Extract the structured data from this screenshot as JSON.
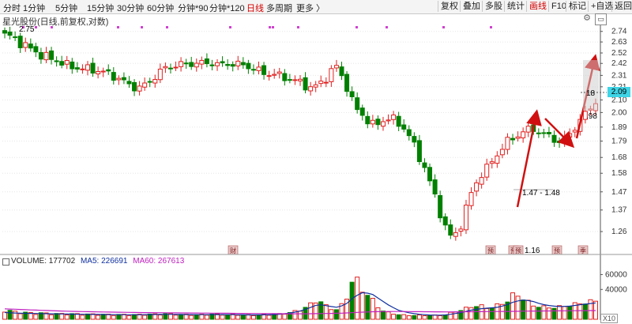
{
  "toolbar": {
    "periods": [
      "分时",
      "1分钟",
      "5分钟",
      "15分钟",
      "30分钟",
      "60分钟",
      "分钟*90",
      "分钟*120",
      "日线",
      "多周期",
      "更多 〉"
    ],
    "active_period": "日线",
    "buttons": [
      "复权",
      "叠加",
      "多股",
      "统计",
      "画线",
      "F10",
      "标记",
      "+自选",
      "返回"
    ],
    "active_button": "画线",
    "settings_icon": "gear-icon"
  },
  "stock_title": "星光股份(日线,前复权,对数)",
  "price_axis": {
    "ticks": [
      2.74,
      2.63,
      2.52,
      2.42,
      2.31,
      2.21,
      2.1,
      2.0,
      1.89,
      1.79,
      1.68,
      1.58,
      1.47,
      1.37,
      1.26
    ],
    "labels": [
      "2.74",
      "2.63",
      "2.52",
      "2.42",
      "2.31",
      "2.21",
      "2.10",
      "2.00",
      "1.89",
      "1.79",
      "1.68",
      "1.58",
      "1.47",
      "1.37",
      "1.26"
    ],
    "current_price_label": "2.09"
  },
  "volume_axis": {
    "ticks": [
      60000,
      40000
    ],
    "labels": [
      "60000",
      "40000"
    ],
    "x10_label": "X10"
  },
  "volume_header": {
    "volume": "VOLUME: 177702",
    "ma5": "MA5: 226691",
    "ma60": "MA60: 267613"
  },
  "annotations": {
    "start_high": "2.75",
    "low": "1.16",
    "range_label": "1.47 - 1.48",
    "box_left": "18",
    "box_right": ".98"
  },
  "event_markers": [
    "财",
    "预",
    "预",
    "预",
    "预",
    "季"
  ],
  "colors": {
    "up": "#e02020",
    "down": "#008000",
    "ma5": "#1030a0",
    "ma60": "#c020c0",
    "arrow": "#d01010",
    "price_tag": "#3fd4e6"
  },
  "chart_data": {
    "type": "candlestick",
    "title": "星光股份(日线,前复权,对数)",
    "scale": "log",
    "ylim": [
      1.16,
      2.78
    ],
    "price_high": 2.75,
    "price_low": 1.16,
    "last_price": 2.09,
    "grid": true,
    "close_path": [
      2.7,
      2.68,
      2.6,
      2.56,
      2.5,
      2.47,
      2.44,
      2.4,
      2.38,
      2.37,
      2.36,
      2.34,
      2.31,
      2.27,
      2.22,
      2.2,
      2.24,
      2.32,
      2.38,
      2.4,
      2.41,
      2.42,
      2.42,
      2.43,
      2.4,
      2.42,
      2.41,
      2.4,
      2.36,
      2.33,
      2.32,
      2.3,
      2.27,
      2.25,
      2.2,
      2.22,
      2.3,
      2.4,
      2.25,
      2.05,
      1.98,
      1.9,
      1.93,
      1.96,
      1.92,
      1.85,
      1.72,
      1.6,
      1.45,
      1.3,
      1.22,
      1.3,
      1.45,
      1.56,
      1.62,
      1.7,
      1.78,
      1.82,
      1.86,
      1.88,
      1.84,
      1.82,
      1.78,
      1.83,
      1.92,
      2.0,
      2.09
    ],
    "volume_path": [
      12000,
      10000,
      9000,
      8000,
      8000,
      7500,
      7000,
      7000,
      6800,
      6500,
      6500,
      6200,
      6000,
      6000,
      5800,
      6000,
      6500,
      6500,
      7000,
      6500,
      6000,
      6000,
      6000,
      6500,
      6500,
      6000,
      6000,
      5500,
      5500,
      6000,
      6000,
      7000,
      9000,
      12000,
      18000,
      26000,
      16000,
      12000,
      22000,
      56000,
      38000,
      26000,
      12000,
      8000,
      6000,
      5000,
      5000,
      5000,
      5000,
      5000,
      9000,
      12000,
      16000,
      18000,
      14000,
      18000,
      22000,
      34000,
      26000,
      18000,
      16000,
      15000,
      16000,
      18000,
      20000,
      22000,
      24000
    ],
    "ma5_path": [
      9000,
      8500,
      8000,
      7800,
      7600,
      7400,
      7200,
      7000,
      6800,
      6600,
      6500,
      6400,
      6200,
      6100,
      6000,
      6000,
      6200,
      6400,
      6600,
      6500,
      6300,
      6200,
      6100,
      6200,
      6300,
      6200,
      6000,
      5900,
      5800,
      5900,
      6200,
      7000,
      8500,
      11000,
      15000,
      20000,
      18000,
      16000,
      19000,
      30000,
      36000,
      34000,
      26000,
      18000,
      12000,
      9000,
      7000,
      6000,
      5500,
      5500,
      7000,
      9000,
      12000,
      14000,
      15000,
      16000,
      19000,
      24000,
      26000,
      24000,
      20000,
      18000,
      17000,
      17500,
      19000,
      20500,
      22000
    ],
    "ma60_path": [
      14000,
      13500,
      13000,
      12500,
      12000,
      11600,
      11200,
      10800,
      10500,
      10200,
      10000,
      9800,
      9600,
      9400,
      9200,
      9000,
      8900,
      8800,
      8700,
      8600,
      8500,
      8400,
      8300,
      8200,
      8100,
      8000,
      7900,
      7800,
      7700,
      7600,
      7500,
      7400,
      7300,
      7300,
      7400,
      7600,
      7800,
      8000,
      8300,
      9000,
      9600,
      10000,
      10300,
      10400,
      10400,
      10300,
      10200,
      10100,
      10000,
      9900,
      9900,
      10000,
      10100,
      10200,
      10300,
      10400,
      10500,
      10700,
      10900,
      11000,
      11100,
      11200,
      11300,
      11400,
      11500,
      11600,
      11700
    ]
  }
}
